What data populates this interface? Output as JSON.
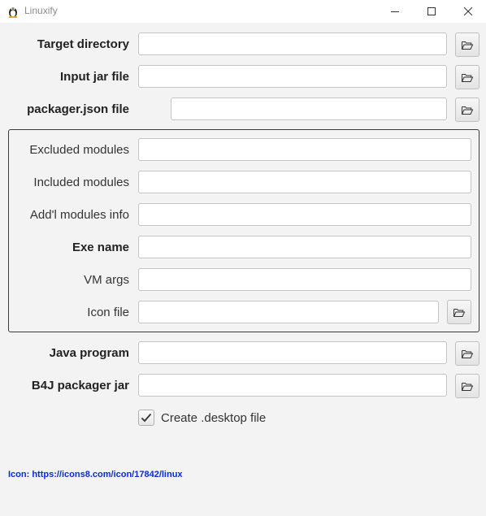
{
  "window": {
    "title": "Linuxify",
    "app_icon": "linux-tux-icon",
    "controls": [
      "minimize-icon",
      "maximize-icon",
      "close-icon"
    ]
  },
  "fields": {
    "target_directory": {
      "label": "Target directory",
      "value": ""
    },
    "input_jar_file": {
      "label": "Input jar file",
      "value": ""
    },
    "packager_json_file": {
      "label": "packager.json file",
      "value": ""
    },
    "excluded_modules": {
      "label": "Excluded modules",
      "value": ""
    },
    "included_modules": {
      "label": "Included modules",
      "value": ""
    },
    "addl_modules_info": {
      "label": "Add'l modules info",
      "value": ""
    },
    "exe_name": {
      "label": "Exe name",
      "value": ""
    },
    "vm_args": {
      "label": "VM args",
      "value": ""
    },
    "icon_file": {
      "label": "Icon file",
      "value": ""
    },
    "java_program": {
      "label": "Java program",
      "value": ""
    },
    "b4j_packager_jar": {
      "label": "B4J packager jar",
      "value": ""
    }
  },
  "browse_icon": "folder-open-icon",
  "desktop_checkbox": {
    "label": "Create .desktop file",
    "checked": true
  },
  "credit": {
    "text": "Icon: https://icons8.com/icon/17842/linux",
    "color": "#0b2bd6"
  }
}
